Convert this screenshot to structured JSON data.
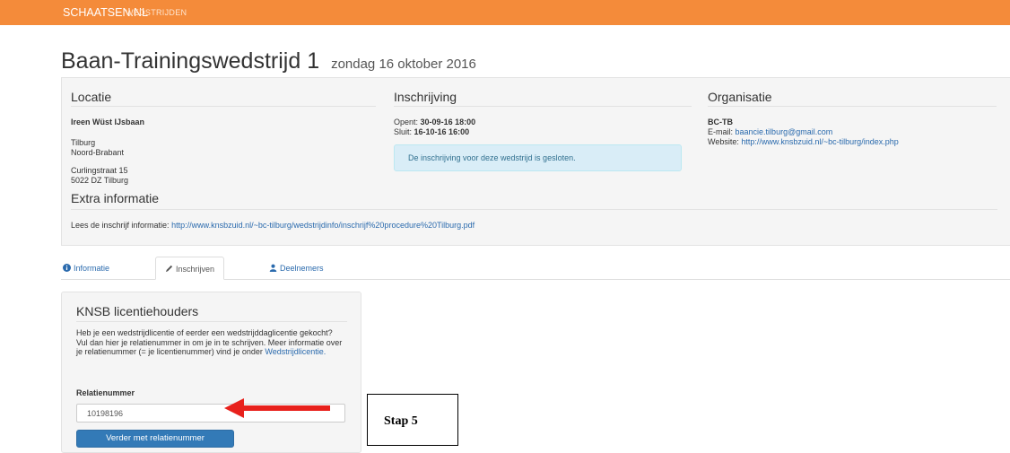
{
  "nav": {
    "brand": "SCHAATSEN.NL",
    "link": "WEDSTRIJDEN",
    "bg_color": "#f48b3a"
  },
  "page": {
    "title": "Baan-Trainingswedstrijd 1",
    "date": "zondag 16 oktober 2016"
  },
  "locatie": {
    "heading": "Locatie",
    "venue": "Ireen Wüst IJsbaan",
    "city": "Tilburg",
    "province": "Noord-Brabant",
    "street": "Curlingstraat 15",
    "postal": "5022 DZ Tilburg"
  },
  "inschrijving": {
    "heading": "Inschrijving",
    "opens_label": "Opent:",
    "opens_value": "30-09-16 18:00",
    "closes_label": "Sluit:",
    "closes_value": "16-10-16 16:00",
    "alert": "De inschrijving voor deze wedstrijd is gesloten."
  },
  "organisatie": {
    "heading": "Organisatie",
    "name": "BC-TB",
    "email_label": "E-mail:",
    "email": "baancie.tilburg@gmail.com",
    "website_label": "Website:",
    "website": "http://www.knsbzuid.nl/~bc-tilburg/index.php"
  },
  "extra": {
    "heading": "Extra informatie",
    "text": "Lees de inschrijf informatie:",
    "link": "http://www.knsbzuid.nl/~bc-tilburg/wedstrijdinfo/inschrijf%20procedure%20Tilburg.pdf"
  },
  "tabs": [
    {
      "label": "Informatie",
      "icon": "info-circle-icon"
    },
    {
      "label": "Inschrijven",
      "icon": "pencil-icon",
      "active": true
    },
    {
      "label": "Deelnemers",
      "icon": "user-icon"
    }
  ],
  "panel": {
    "heading": "KNSB licentiehouders",
    "description": "Heb je een wedstrijdlicentie of eerder een wedstrijddaglicentie gekocht? Vul dan hier je relatienummer in om je in te schrijven. Meer informatie over je relatienummer (= je licentienummer) vind je onder",
    "description_link": "Wedstrijdlicentie.",
    "field_label": "Relatienummer",
    "field_value": "10198196",
    "submit_label": "Verder met relatienummer"
  },
  "annotation": {
    "label": "Stap 5",
    "arrow_color": "#e8211c"
  }
}
